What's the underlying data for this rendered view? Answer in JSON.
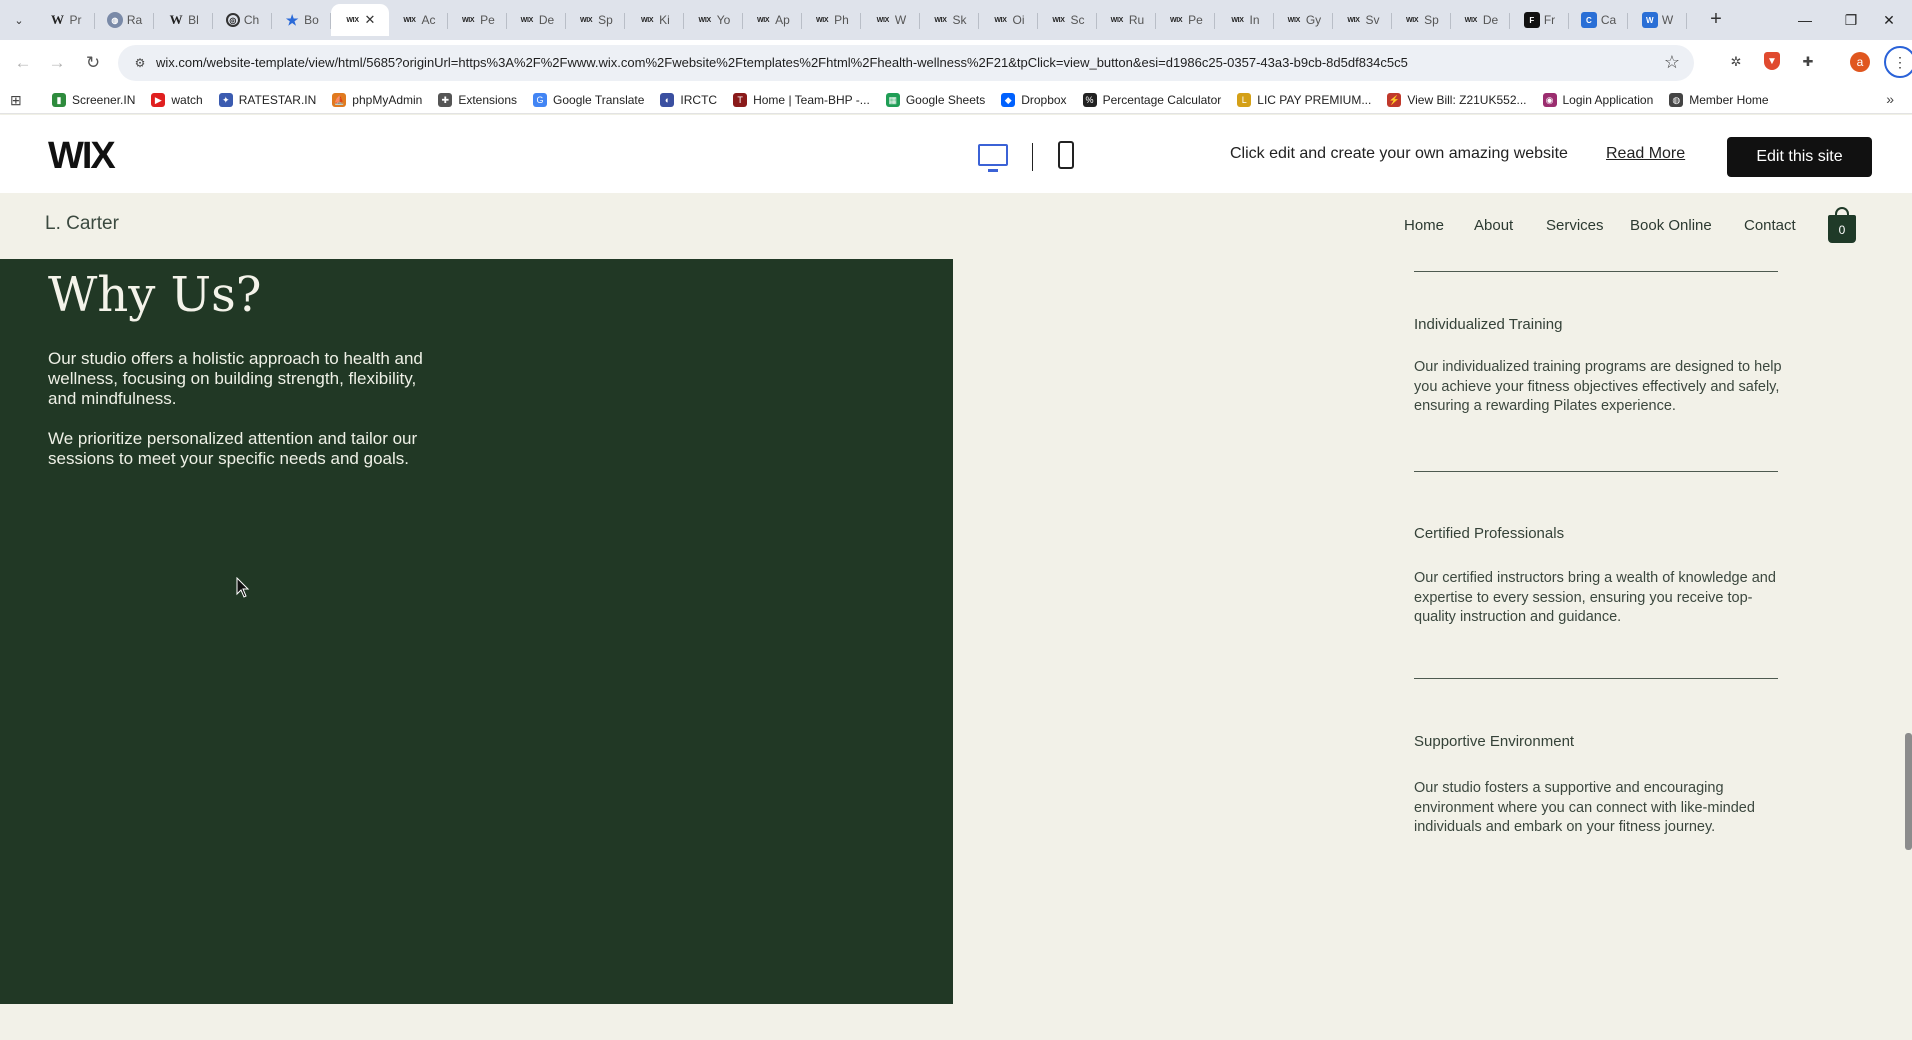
{
  "browser": {
    "tabs": [
      {
        "icon": "W",
        "kind": "w",
        "label": "Pr"
      },
      {
        "icon": "◍",
        "kind": "globe",
        "label": "Ra"
      },
      {
        "icon": "W",
        "kind": "w",
        "label": "Bl"
      },
      {
        "icon": "◎",
        "kind": "chat",
        "label": "Ch"
      },
      {
        "icon": "★",
        "kind": "star",
        "label": "Bo"
      },
      {
        "icon": "WIX",
        "kind": "wix",
        "label": "",
        "active": true
      },
      {
        "icon": "WIX",
        "kind": "wix",
        "label": "Ac"
      },
      {
        "icon": "WIX",
        "kind": "wix",
        "label": "Pe"
      },
      {
        "icon": "WIX",
        "kind": "wix",
        "label": "De"
      },
      {
        "icon": "WIX",
        "kind": "wix",
        "label": "Sp"
      },
      {
        "icon": "WIX",
        "kind": "wix",
        "label": "Ki"
      },
      {
        "icon": "WIX",
        "kind": "wix",
        "label": "Yo"
      },
      {
        "icon": "WIX",
        "kind": "wix",
        "label": "Ap"
      },
      {
        "icon": "WIX",
        "kind": "wix",
        "label": "Ph"
      },
      {
        "icon": "WIX",
        "kind": "wix",
        "label": "W"
      },
      {
        "icon": "WIX",
        "kind": "wix",
        "label": "Sk"
      },
      {
        "icon": "WIX",
        "kind": "wix",
        "label": "Oi"
      },
      {
        "icon": "WIX",
        "kind": "wix",
        "label": "Sc"
      },
      {
        "icon": "WIX",
        "kind": "wix",
        "label": "Ru"
      },
      {
        "icon": "WIX",
        "kind": "wix",
        "label": "Pe"
      },
      {
        "icon": "WIX",
        "kind": "wix",
        "label": "In"
      },
      {
        "icon": "WIX",
        "kind": "wix",
        "label": "Gy"
      },
      {
        "icon": "WIX",
        "kind": "wix",
        "label": "Sv"
      },
      {
        "icon": "WIX",
        "kind": "wix",
        "label": "Sp"
      },
      {
        "icon": "WIX",
        "kind": "wix",
        "label": "De"
      },
      {
        "icon": "F",
        "kind": "fr",
        "label": "Fr"
      },
      {
        "icon": "C",
        "kind": "ca",
        "label": "Ca"
      },
      {
        "icon": "W",
        "kind": "blue",
        "label": "W"
      }
    ],
    "active_tab_close": "✕",
    "new_tab": "+",
    "window_controls": {
      "minimize": "—",
      "restore": "❐",
      "close": "✕"
    },
    "url": "wix.com/website-template/view/html/5685?originUrl=https%3A%2F%2Fwww.wix.com%2Fwebsite%2Ftemplates%2Fhtml%2Fhealth-wellness%2F21&tpClick=view_button&esi=d1986c25-0357-43a3-b9cb-8d5df834c5c5",
    "profile_initial": "a",
    "bookmarks": [
      {
        "label": "Screener.IN",
        "color": "#2e8b3d",
        "glyph": "▮"
      },
      {
        "label": "watch",
        "color": "#e01f1f",
        "glyph": "▶"
      },
      {
        "label": "RATESTAR.IN",
        "color": "#3b5bb0",
        "glyph": "✦"
      },
      {
        "label": "phpMyAdmin",
        "color": "#e07a1f",
        "glyph": "⛵"
      },
      {
        "label": "Extensions",
        "color": "#555555",
        "glyph": "✚"
      },
      {
        "label": "Google Translate",
        "color": "#4285f4",
        "glyph": "G"
      },
      {
        "label": "IRCTC",
        "color": "#3a4fa0",
        "glyph": "◐"
      },
      {
        "label": "Home | Team-BHP -...",
        "color": "#8a1a1a",
        "glyph": "T"
      },
      {
        "label": "Google Sheets",
        "color": "#1f9d55",
        "glyph": "▦"
      },
      {
        "label": "Dropbox",
        "color": "#0061fe",
        "glyph": "◆"
      },
      {
        "label": "Percentage Calculator",
        "color": "#222222",
        "glyph": "%"
      },
      {
        "label": "LIC PAY PREMIUM...",
        "color": "#d4a017",
        "glyph": "L"
      },
      {
        "label": "View Bill: Z21UK552...",
        "color": "#c0392b",
        "glyph": "⚡"
      },
      {
        "label": "Login Application",
        "color": "#9b2d6f",
        "glyph": "◉"
      },
      {
        "label": "Member Home",
        "color": "#444444",
        "glyph": "◍"
      }
    ]
  },
  "wix": {
    "logo": "WIX",
    "message": "Click edit and create your own amazing website",
    "read_more": "Read More",
    "edit_button": "Edit this site"
  },
  "site": {
    "brand": "L. Carter",
    "nav": [
      "Home",
      "About",
      "Services",
      "Book Online",
      "Contact"
    ],
    "cart_count": "0",
    "why_title": "Why Us?",
    "why_paragraphs": [
      "Our studio offers a holistic approach to health and wellness, focusing on building strength, flexibility, and mindfulness.",
      "We prioritize personalized attention and tailor our sessions to meet your specific needs and goals."
    ],
    "features": [
      {
        "title": "Individualized Training",
        "desc": "Our individualized training programs are designed to help you achieve your fitness objectives effectively and safely, ensuring a rewarding Pilates experience."
      },
      {
        "title": "Certified Professionals",
        "desc": "Our certified instructors bring a wealth of knowledge and expertise to every session, ensuring you receive top-quality instruction and guidance."
      },
      {
        "title": "Supportive Environment",
        "desc": "Our studio fosters a supportive and encouraging environment where you can connect with like-minded individuals and embark on your fitness journey."
      }
    ],
    "colors": {
      "panel": "#213825",
      "background": "#f2f1e8",
      "accent": "#3b62d6"
    }
  }
}
